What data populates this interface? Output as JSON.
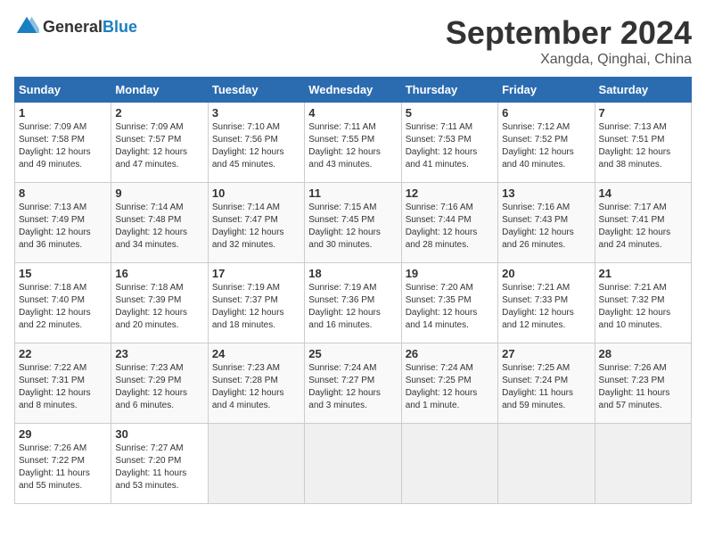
{
  "header": {
    "logo_general": "General",
    "logo_blue": "Blue",
    "month_year": "September 2024",
    "location": "Xangda, Qinghai, China"
  },
  "weekdays": [
    "Sunday",
    "Monday",
    "Tuesday",
    "Wednesday",
    "Thursday",
    "Friday",
    "Saturday"
  ],
  "weeks": [
    [
      {
        "day": "1",
        "info": "Sunrise: 7:09 AM\nSunset: 7:58 PM\nDaylight: 12 hours\nand 49 minutes."
      },
      {
        "day": "2",
        "info": "Sunrise: 7:09 AM\nSunset: 7:57 PM\nDaylight: 12 hours\nand 47 minutes."
      },
      {
        "day": "3",
        "info": "Sunrise: 7:10 AM\nSunset: 7:56 PM\nDaylight: 12 hours\nand 45 minutes."
      },
      {
        "day": "4",
        "info": "Sunrise: 7:11 AM\nSunset: 7:55 PM\nDaylight: 12 hours\nand 43 minutes."
      },
      {
        "day": "5",
        "info": "Sunrise: 7:11 AM\nSunset: 7:53 PM\nDaylight: 12 hours\nand 41 minutes."
      },
      {
        "day": "6",
        "info": "Sunrise: 7:12 AM\nSunset: 7:52 PM\nDaylight: 12 hours\nand 40 minutes."
      },
      {
        "day": "7",
        "info": "Sunrise: 7:13 AM\nSunset: 7:51 PM\nDaylight: 12 hours\nand 38 minutes."
      }
    ],
    [
      {
        "day": "8",
        "info": "Sunrise: 7:13 AM\nSunset: 7:49 PM\nDaylight: 12 hours\nand 36 minutes."
      },
      {
        "day": "9",
        "info": "Sunrise: 7:14 AM\nSunset: 7:48 PM\nDaylight: 12 hours\nand 34 minutes."
      },
      {
        "day": "10",
        "info": "Sunrise: 7:14 AM\nSunset: 7:47 PM\nDaylight: 12 hours\nand 32 minutes."
      },
      {
        "day": "11",
        "info": "Sunrise: 7:15 AM\nSunset: 7:45 PM\nDaylight: 12 hours\nand 30 minutes."
      },
      {
        "day": "12",
        "info": "Sunrise: 7:16 AM\nSunset: 7:44 PM\nDaylight: 12 hours\nand 28 minutes."
      },
      {
        "day": "13",
        "info": "Sunrise: 7:16 AM\nSunset: 7:43 PM\nDaylight: 12 hours\nand 26 minutes."
      },
      {
        "day": "14",
        "info": "Sunrise: 7:17 AM\nSunset: 7:41 PM\nDaylight: 12 hours\nand 24 minutes."
      }
    ],
    [
      {
        "day": "15",
        "info": "Sunrise: 7:18 AM\nSunset: 7:40 PM\nDaylight: 12 hours\nand 22 minutes."
      },
      {
        "day": "16",
        "info": "Sunrise: 7:18 AM\nSunset: 7:39 PM\nDaylight: 12 hours\nand 20 minutes."
      },
      {
        "day": "17",
        "info": "Sunrise: 7:19 AM\nSunset: 7:37 PM\nDaylight: 12 hours\nand 18 minutes."
      },
      {
        "day": "18",
        "info": "Sunrise: 7:19 AM\nSunset: 7:36 PM\nDaylight: 12 hours\nand 16 minutes."
      },
      {
        "day": "19",
        "info": "Sunrise: 7:20 AM\nSunset: 7:35 PM\nDaylight: 12 hours\nand 14 minutes."
      },
      {
        "day": "20",
        "info": "Sunrise: 7:21 AM\nSunset: 7:33 PM\nDaylight: 12 hours\nand 12 minutes."
      },
      {
        "day": "21",
        "info": "Sunrise: 7:21 AM\nSunset: 7:32 PM\nDaylight: 12 hours\nand 10 minutes."
      }
    ],
    [
      {
        "day": "22",
        "info": "Sunrise: 7:22 AM\nSunset: 7:31 PM\nDaylight: 12 hours\nand 8 minutes."
      },
      {
        "day": "23",
        "info": "Sunrise: 7:23 AM\nSunset: 7:29 PM\nDaylight: 12 hours\nand 6 minutes."
      },
      {
        "day": "24",
        "info": "Sunrise: 7:23 AM\nSunset: 7:28 PM\nDaylight: 12 hours\nand 4 minutes."
      },
      {
        "day": "25",
        "info": "Sunrise: 7:24 AM\nSunset: 7:27 PM\nDaylight: 12 hours\nand 3 minutes."
      },
      {
        "day": "26",
        "info": "Sunrise: 7:24 AM\nSunset: 7:25 PM\nDaylight: 12 hours\nand 1 minute."
      },
      {
        "day": "27",
        "info": "Sunrise: 7:25 AM\nSunset: 7:24 PM\nDaylight: 11 hours\nand 59 minutes."
      },
      {
        "day": "28",
        "info": "Sunrise: 7:26 AM\nSunset: 7:23 PM\nDaylight: 11 hours\nand 57 minutes."
      }
    ],
    [
      {
        "day": "29",
        "info": "Sunrise: 7:26 AM\nSunset: 7:22 PM\nDaylight: 11 hours\nand 55 minutes."
      },
      {
        "day": "30",
        "info": "Sunrise: 7:27 AM\nSunset: 7:20 PM\nDaylight: 11 hours\nand 53 minutes."
      },
      {
        "day": "",
        "info": ""
      },
      {
        "day": "",
        "info": ""
      },
      {
        "day": "",
        "info": ""
      },
      {
        "day": "",
        "info": ""
      },
      {
        "day": "",
        "info": ""
      }
    ]
  ]
}
